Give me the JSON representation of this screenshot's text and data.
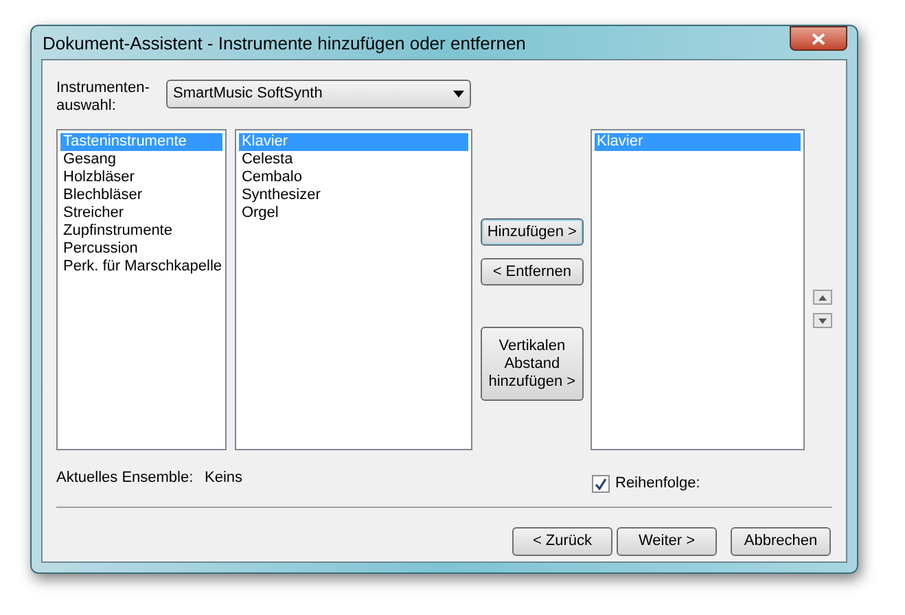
{
  "window": {
    "title": "Dokument-Assistent - Instrumente hinzufügen oder entfernen"
  },
  "instrument_selection": {
    "label_lines": [
      "Instrumenten-",
      "auswahl:"
    ],
    "value": "SmartMusic SoftSynth"
  },
  "categories": [
    {
      "label": "Tasteninstrumente",
      "selected": true
    },
    {
      "label": "Gesang",
      "selected": false
    },
    {
      "label": "Holzbläser",
      "selected": false
    },
    {
      "label": "Blechbläser",
      "selected": false
    },
    {
      "label": "Streicher",
      "selected": false
    },
    {
      "label": "Zupfinstrumente",
      "selected": false
    },
    {
      "label": "Percussion",
      "selected": false
    },
    {
      "label": "Perk. für Marschkapelle",
      "selected": false
    }
  ],
  "instruments": [
    {
      "label": "Klavier",
      "selected": true
    },
    {
      "label": "Celesta",
      "selected": false
    },
    {
      "label": "Cembalo",
      "selected": false
    },
    {
      "label": "Synthesizer",
      "selected": false
    },
    {
      "label": "Orgel",
      "selected": false
    }
  ],
  "middle_buttons": [
    {
      "label": "Hinzufügen >",
      "focused": true
    },
    {
      "label": "< Entfernen",
      "focused": false
    },
    {
      "label": "Vertikalen Abstand hinzufügen >",
      "focused": false
    }
  ],
  "ensemble_list": [
    {
      "label": "Klavier",
      "selected": true
    }
  ],
  "current_ensemble": {
    "label": "Aktuelles Ensemble:",
    "value": "Keins"
  },
  "order_checkbox": {
    "label": "Reihenfolge:",
    "checked": true
  },
  "footer_buttons": [
    "< Zurück",
    "Weiter >",
    "Abbrechen"
  ]
}
